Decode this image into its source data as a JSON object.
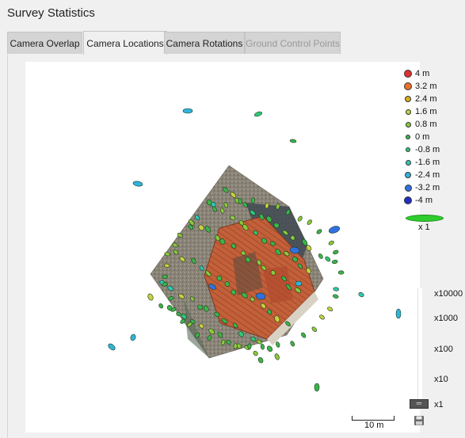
{
  "window": {
    "title": "Survey Statistics"
  },
  "tabs": [
    {
      "label": "Camera Overlap",
      "state": "normal"
    },
    {
      "label": "Camera Locations",
      "state": "active"
    },
    {
      "label": "Camera Rotations",
      "state": "normal"
    },
    {
      "label": "Ground Control Points",
      "state": "disabled"
    }
  ],
  "legend": {
    "entries": [
      {
        "label": "4 m",
        "color": "#e03030"
      },
      {
        "label": "3.2 m",
        "color": "#e8702a"
      },
      {
        "label": "2.4 m",
        "color": "#d8b020"
      },
      {
        "label": "1.6 m",
        "color": "#c8d040"
      },
      {
        "label": "0.8 m",
        "color": "#8cc83c"
      },
      {
        "label": "0 m",
        "color": "#3cb44a"
      },
      {
        "label": "-0.8 m",
        "color": "#30c878"
      },
      {
        "label": "-1.6 m",
        "color": "#30c8b4"
      },
      {
        "label": "-2.4 m",
        "color": "#30b4dc"
      },
      {
        "label": "-3.2 m",
        "color": "#3070e0"
      },
      {
        "label": "-4 m",
        "color": "#2030c0"
      }
    ],
    "ellipse_scale_label": "x 1",
    "ellipse_color": "#2ecc2e"
  },
  "zoom": {
    "ticks": [
      "x10000",
      "x1000",
      "x100",
      "x10",
      "x1"
    ],
    "current": "x1"
  },
  "scale_bar": {
    "label": "10 m"
  },
  "icons": {
    "save": "save-icon",
    "zoom_handle": "slider-handle-icon"
  }
}
